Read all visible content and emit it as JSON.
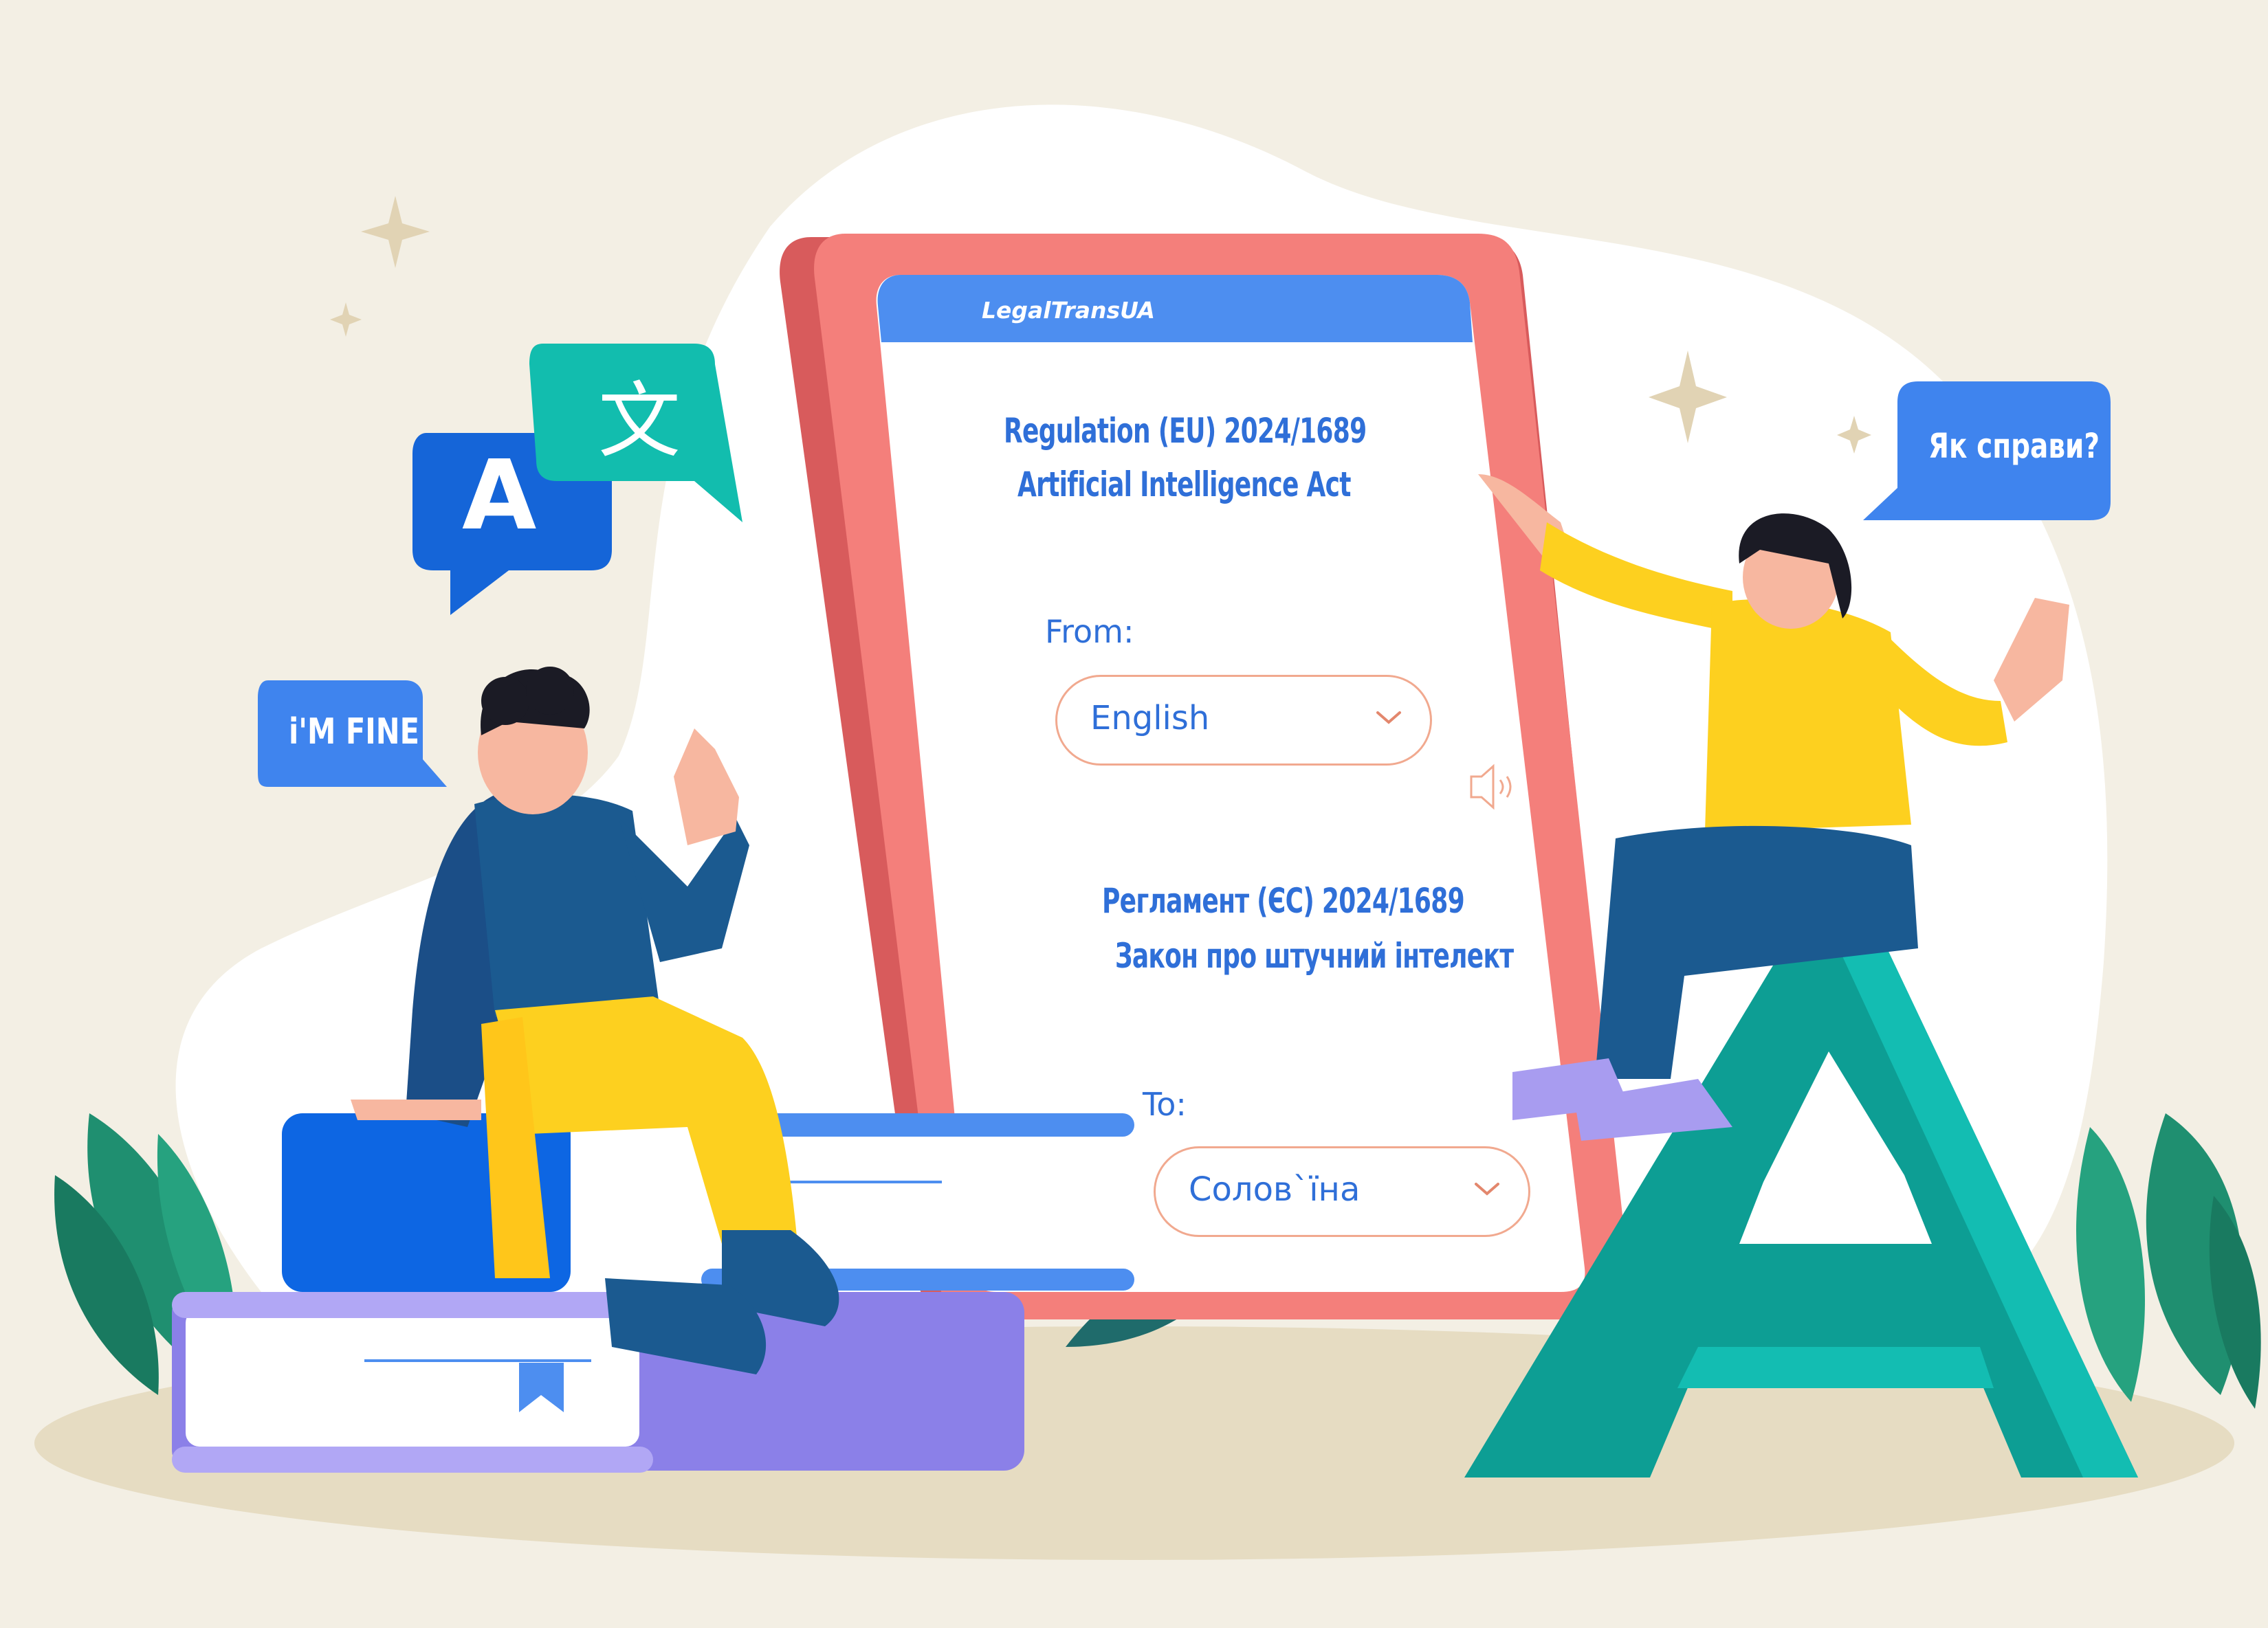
{
  "app": {
    "brand": "LegalTransUA"
  },
  "document": {
    "source_title_line1": "Regulation (EU) 2024/1689",
    "source_title_line2": "Artificial Intelligence Act",
    "target_title_line1": "Регламент (ЄС) 2024/1689",
    "target_title_line2": "Закон про штучний інтелект"
  },
  "from": {
    "label": "From:",
    "value": "English"
  },
  "to": {
    "label": "To:",
    "value": "Солов`їна"
  },
  "bubbles": {
    "left_message": "i'M FINE",
    "right_message": "Як справи?",
    "letter_a": "A",
    "chinese_char": "文"
  },
  "icons": {
    "speaker": "speaker-icon",
    "chevron": "chevron-down-icon",
    "bookmark": "bookmark-icon"
  },
  "colors": {
    "background": "#f3efe4",
    "blob": "#ffffff",
    "tablet_frame": "#f47f7b",
    "tablet_shadow": "#d85b5c",
    "header_blue": "#4d8ef0",
    "text_blue": "#2f6fd8",
    "select_border": "#f1a98f",
    "teal": "#13b8ad",
    "yellow": "#fdd01f",
    "navy": "#1d5a8c"
  }
}
